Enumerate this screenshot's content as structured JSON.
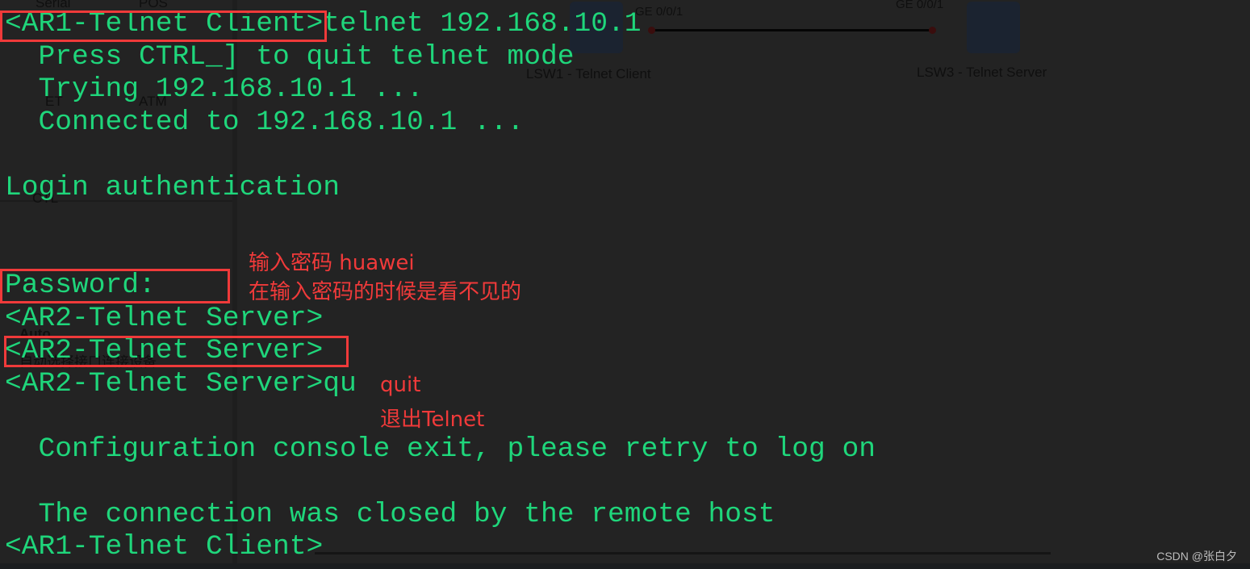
{
  "background": {
    "panel_labels": [
      "Serial",
      "POS",
      "ET",
      "ATM",
      "CTL",
      "Auto",
      "自动选择接口连接设备"
    ],
    "topology": {
      "left_device": "LSW1 - Telnet Client",
      "right_device": "LSW3 - Telnet Server",
      "left_port": "GE 0/0/1",
      "right_port": "GE 0/0/1"
    }
  },
  "terminal": {
    "text_color": "#1fd67b",
    "lines": [
      {
        "text": "<AR1-Telnet Client>telnet 192.168.10.1"
      },
      {
        "text": "  Press CTRL_] to quit telnet mode"
      },
      {
        "text": "  Trying 192.168.10.1 ..."
      },
      {
        "text": "  Connected to 192.168.10.1 ..."
      },
      {
        "text": ""
      },
      {
        "text": "Login authentication"
      },
      {
        "text": ""
      },
      {
        "text": ""
      },
      {
        "text": "Password:"
      },
      {
        "text": "<AR2-Telnet Server>"
      },
      {
        "text": "<AR2-Telnet Server>"
      },
      {
        "text": "<AR2-Telnet Server>qu"
      },
      {
        "text": ""
      },
      {
        "text": "  Configuration console exit, please retry to log on"
      },
      {
        "text": ""
      },
      {
        "text": "  The connection was closed by the remote host"
      },
      {
        "text": "<AR1-Telnet Client>"
      }
    ]
  },
  "annotations": {
    "color": "#f03a3a",
    "password_note_1": "输入密码 huawei",
    "password_note_2": "在输入密码的时候是看不见的",
    "quit_note_1": "quit",
    "quit_note_2": "退出Telnet"
  },
  "watermark": "CSDN @张白夕"
}
